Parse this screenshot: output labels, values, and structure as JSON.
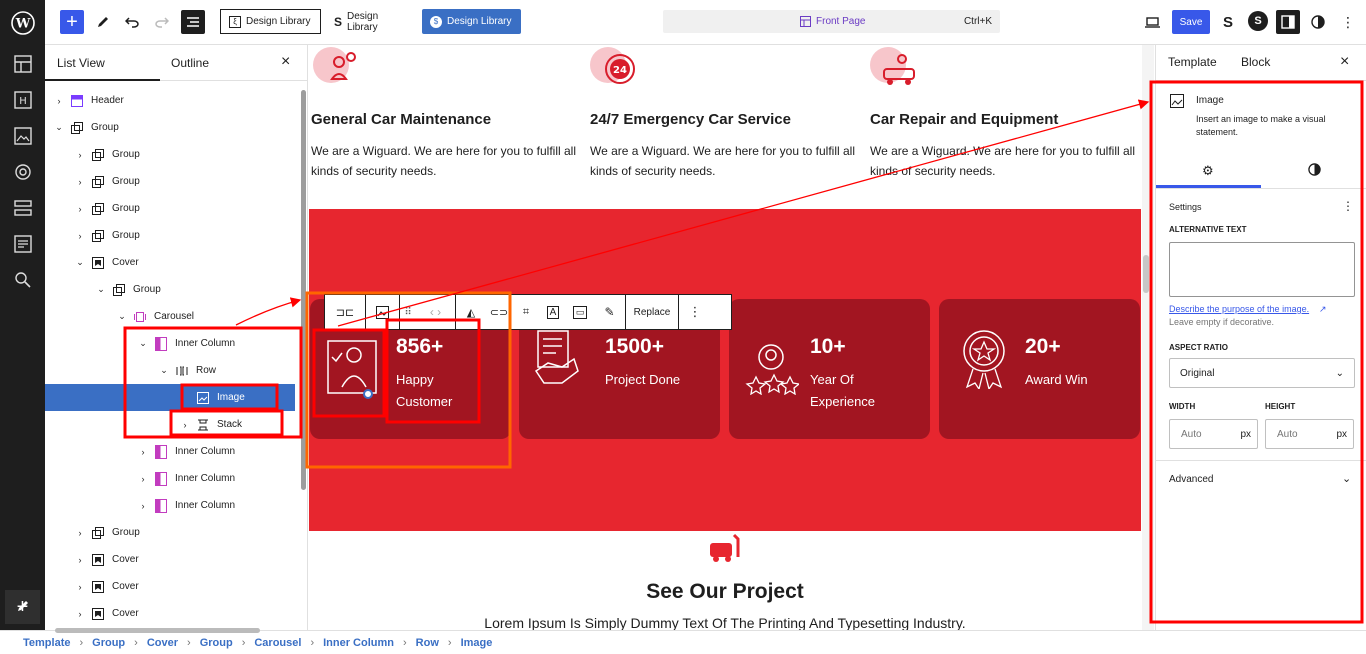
{
  "topbar": {
    "design_library_buttons": [
      "Design Library",
      "Design Library",
      "Design Library"
    ],
    "command_bar": {
      "page": "Front Page",
      "shortcut": "Ctrl+K"
    },
    "save_label": "Save"
  },
  "list_view": {
    "tabs": [
      "List View",
      "Outline"
    ],
    "close": "×",
    "rows": [
      {
        "label": "Header",
        "depth": 0,
        "chevron": "›",
        "icon": "header-icon"
      },
      {
        "label": "Group",
        "depth": 0,
        "chevron": "⌄",
        "icon": "group-icon"
      },
      {
        "label": "Group",
        "depth": 1,
        "chevron": "›",
        "icon": "group-icon"
      },
      {
        "label": "Group",
        "depth": 1,
        "chevron": "›",
        "icon": "group-icon"
      },
      {
        "label": "Group",
        "depth": 1,
        "chevron": "›",
        "icon": "group-icon"
      },
      {
        "label": "Group",
        "depth": 1,
        "chevron": "›",
        "icon": "group-icon"
      },
      {
        "label": "Cover",
        "depth": 1,
        "chevron": "⌄",
        "icon": "cover-icon"
      },
      {
        "label": "Group",
        "depth": 2,
        "chevron": "⌄",
        "icon": "group-icon"
      },
      {
        "label": "Carousel",
        "depth": 3,
        "chevron": "⌄",
        "icon": "carousel-icon"
      },
      {
        "label": "Inner Column",
        "depth": 4,
        "chevron": "⌄",
        "icon": "column-icon"
      },
      {
        "label": "Row",
        "depth": 5,
        "chevron": "⌄",
        "icon": "row-icon"
      },
      {
        "label": "Image",
        "depth": 6,
        "chevron": "",
        "icon": "image-icon",
        "selected": true
      },
      {
        "label": "Stack",
        "depth": 6,
        "chevron": "›",
        "icon": "stack-icon"
      },
      {
        "label": "Inner Column",
        "depth": 4,
        "chevron": "›",
        "icon": "column-icon"
      },
      {
        "label": "Inner Column",
        "depth": 4,
        "chevron": "›",
        "icon": "column-icon"
      },
      {
        "label": "Inner Column",
        "depth": 4,
        "chevron": "›",
        "icon": "column-icon"
      },
      {
        "label": "Group",
        "depth": 1,
        "chevron": "›",
        "icon": "group-icon"
      },
      {
        "label": "Cover",
        "depth": 1,
        "chevron": "›",
        "icon": "cover-icon"
      },
      {
        "label": "Cover",
        "depth": 1,
        "chevron": "›",
        "icon": "cover-icon"
      },
      {
        "label": "Cover",
        "depth": 1,
        "chevron": "›",
        "icon": "cover-icon"
      }
    ]
  },
  "canvas": {
    "services": [
      {
        "title": "General Car Maintenance",
        "desc": "We are a Wiguard. We are here for you to fulfill all kinds of security needs."
      },
      {
        "title": "24/7 Emergency Car Service",
        "desc": "We are a Wiguard. We are here for you to fulfill all kinds of security needs."
      },
      {
        "title": "Car Repair and Equipment",
        "desc": "We are a Wiguard. We are here for you to fulfill all kinds of security needs."
      }
    ],
    "stats": [
      {
        "num": "856+",
        "label": "Happy Customer"
      },
      {
        "num": "1500+",
        "label": "Project Done"
      },
      {
        "num": "10+",
        "label": "Year Of Experience"
      },
      {
        "num": "20+",
        "label": "Award Win"
      }
    ],
    "block_toolbar": {
      "replace": "Replace"
    },
    "project": {
      "title": "See Our Project",
      "subtitle": "Lorem Ipsum Is Simply Dummy Text Of The Printing And Typesetting Industry."
    }
  },
  "settings": {
    "tabs": [
      "Template",
      "Block"
    ],
    "close": "×",
    "block": {
      "name": "Image",
      "desc": "Insert an image to make a visual statement."
    },
    "section_settings": "Settings",
    "alt_label": "ALTERNATIVE TEXT",
    "alt_link": "Describe the purpose of the image.",
    "alt_help": "Leave empty if decorative.",
    "aspect_label": "ASPECT RATIO",
    "aspect_value": "Original",
    "width_label": "WIDTH",
    "height_label": "HEIGHT",
    "dim_placeholder": "Auto",
    "dim_unit": "px",
    "advanced": "Advanced"
  },
  "breadcrumb": [
    "Template",
    "Group",
    "Cover",
    "Group",
    "Carousel",
    "Inner Column",
    "Row",
    "Image"
  ],
  "colors": {
    "accent": "#3858e9",
    "brand_red": "#e7262f",
    "card_red": "#a21521",
    "annotation_red": "#ff0000",
    "annotation_orange": "#ff6600"
  }
}
